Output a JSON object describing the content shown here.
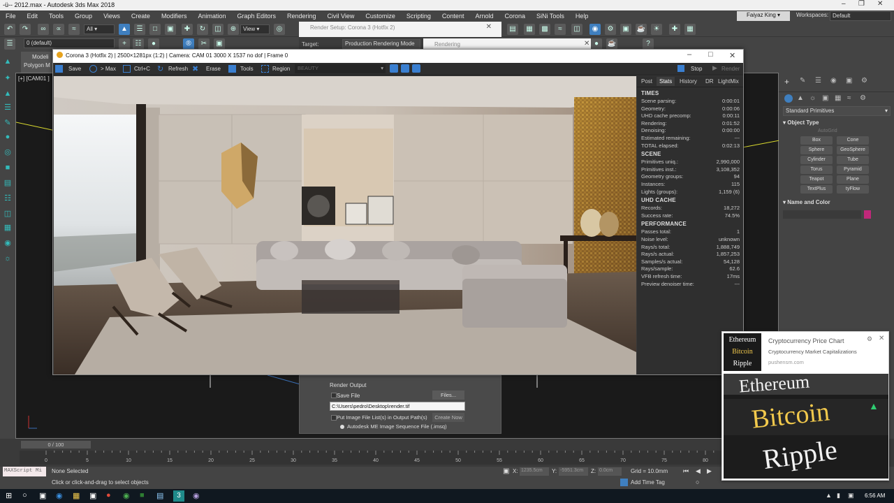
{
  "window": {
    "title": "-ü-- 2012.max - Autodesk 3ds Max 2018"
  },
  "menu": [
    "File",
    "Edit",
    "Tools",
    "Group",
    "Views",
    "Create",
    "Modifiers",
    "Animation",
    "Graph Editors",
    "Rendering",
    "Civil View",
    "Customize",
    "Scripting",
    "Content",
    "Arnold",
    "Corona",
    "SiNi Tools",
    "Help"
  ],
  "user": {
    "name": "Faiyaz King",
    "workspace_label": "Workspaces:",
    "workspace": "Default"
  },
  "toolbar": {
    "filter": "All",
    "view": "View",
    "layer": "0 (default)"
  },
  "render_setup": {
    "title": "Render Setup: Corona 3 (Hotfix 2)",
    "target_label": "Target:",
    "target": "Production Rendering Mode",
    "rendering_tab": "Rendering",
    "output_section": "Render Output",
    "save_file": "Save File",
    "files_button": "Files...",
    "path": "C:\\Users\\pedro\\Desktop\\render.tif",
    "put_image": "Put Image File List(s) in Output Path(s)",
    "create_now": "Create Now",
    "autodesk_me": "Autodesk ME Image Sequence File (.imsq)"
  },
  "left_tabs": {
    "modeling": "Modeli",
    "polygon": "Polygon M",
    "viewport_label": "[+] [CAM01 ]"
  },
  "vfb": {
    "title": "Corona 3 (Hotfix 2) | 2500×1281px (1:2) | Camera: CAM 01 3000 X 1537 no dof | Frame 0",
    "toolbar": {
      "save": "Save",
      "max": "> Max",
      "ctrlc": "Ctrl+C",
      "refresh": "Refresh",
      "erase": "Erase",
      "tools": "Tools",
      "region": "Region",
      "beauty": "BEAUTY",
      "stop": "Stop",
      "render": "Render"
    },
    "tabs": [
      "Post",
      "Stats",
      "History",
      "DR",
      "LightMix"
    ],
    "active_tab": "Stats",
    "sections": [
      {
        "title": "TIMES",
        "rows": [
          [
            "Scene parsing:",
            "0:00:01"
          ],
          [
            "Geometry:",
            "0:00:06"
          ],
          [
            "UHD cache precomp:",
            "0:00:11"
          ],
          [
            "Rendering:",
            "0:01:52"
          ],
          [
            "Denoising:",
            "0:00:00"
          ],
          [
            "Estimated remaining:",
            "---"
          ],
          [
            "TOTAL elapsed:",
            "0:02:13"
          ]
        ]
      },
      {
        "title": "SCENE",
        "rows": [
          [
            "Primitives uniq.:",
            "2,990,000"
          ],
          [
            "Primitives inst.:",
            "3,108,352"
          ],
          [
            "Geometry groups:",
            "94"
          ],
          [
            "Instances:",
            "115"
          ],
          [
            "Lights (groups):",
            "1,159 (6)"
          ]
        ]
      },
      {
        "title": "UHD CACHE",
        "rows": [
          [
            "Records:",
            "18,272"
          ],
          [
            "Success rate:",
            "74.5%"
          ]
        ]
      },
      {
        "title": "PERFORMANCE",
        "rows": [
          [
            "Passes total:",
            "1"
          ],
          [
            "Noise level:",
            "unknown"
          ],
          [
            "Rays/s total:",
            "1,888,749"
          ],
          [
            "Rays/s actual:",
            "1,857,253"
          ],
          [
            "Samples/s actual:",
            "54,128"
          ],
          [
            "Rays/sample:",
            "62.6"
          ],
          [
            "VFB refresh time:",
            "17ms"
          ],
          [
            "Preview denoiser time:",
            "---"
          ]
        ]
      }
    ]
  },
  "command_panel": {
    "dropdown": "Standard Primitives",
    "object_type": "Object Type",
    "autogrid": "AutoGrid",
    "buttons": [
      "Box",
      "Cone",
      "Sphere",
      "GeoSphere",
      "Cylinder",
      "Tube",
      "Torus",
      "Pyramid",
      "Teapot",
      "Plane",
      "TextPlus",
      "tyFlow"
    ],
    "name_color": "Name and Color",
    "color_swatch": "#c0287a"
  },
  "timeline": {
    "frame": "0 / 100",
    "ticks": [
      "0",
      "5",
      "10",
      "15",
      "20",
      "25",
      "30",
      "35",
      "40",
      "45",
      "50",
      "55",
      "60",
      "65",
      "70",
      "75",
      "80",
      "85",
      "90"
    ]
  },
  "status": {
    "script": "MAXScript Mi",
    "none_selected": "None Selected",
    "hint": "Click or click-and-drag to select objects",
    "x_label": "X:",
    "x_value": "1235.5cm",
    "y_label": "Y:",
    "y_value": "-5951.3cm",
    "z_label": "Z:",
    "z_value": "0.0cm",
    "grid": "Grid = 10.0mm",
    "add_time_tag": "Add Time Tag"
  },
  "taskbar": {
    "time": "6:56 AM"
  },
  "popup": {
    "title": "Cryptocurrency Price Chart",
    "subtitle": "Cryptocurrency Market Capitalizations",
    "site": "pushensm.com",
    "logo_words": [
      "Ethereum",
      "Bitcoin",
      "Ripple"
    ],
    "image_words": [
      "Ethereum",
      "Bitcoin",
      "Ripple"
    ]
  }
}
